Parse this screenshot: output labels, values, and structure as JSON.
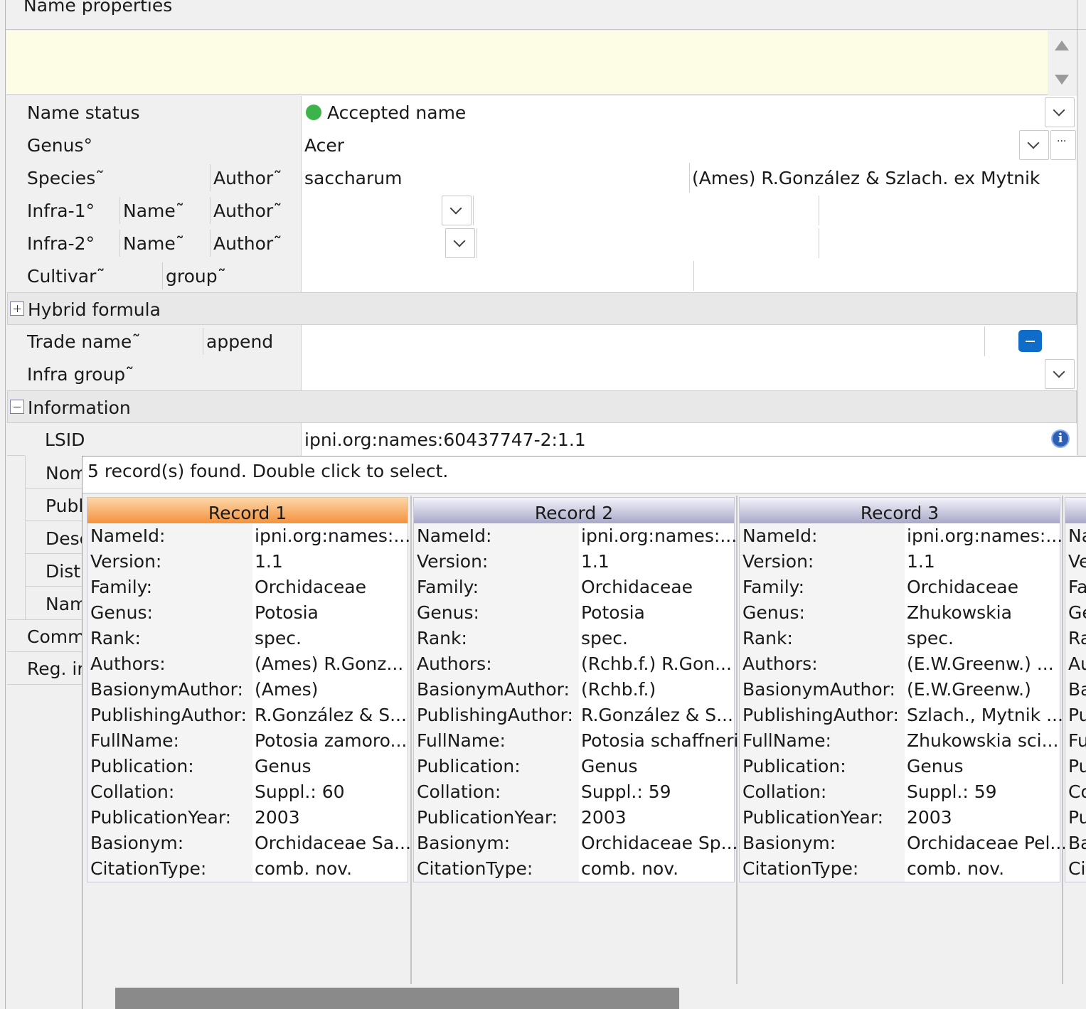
{
  "panel": {
    "title": "Name properties"
  },
  "fields": {
    "name_status": {
      "label": "Name status",
      "value": "Accepted name"
    },
    "genus": {
      "label": "Genus°",
      "value": "Acer",
      "browse": "···"
    },
    "species": {
      "label": "Species˜",
      "author_label": "Author˜",
      "value": "saccharum",
      "author_value": "(Ames) R.González & Szlach. ex Mytnik"
    },
    "infra1": {
      "label": "Infra-1°",
      "name_label": "Name˜",
      "author_label": "Author˜"
    },
    "infra2": {
      "label": "Infra-2°",
      "name_label": "Name˜",
      "author_label": "Author˜"
    },
    "cultivar": {
      "label": "Cultivar˜",
      "group_label": "group˜"
    },
    "hybrid_formula": {
      "label": "Hybrid formula"
    },
    "trade_name": {
      "label": "Trade name˜",
      "append_label": "append"
    },
    "infra_group": {
      "label": "Infra group˜"
    },
    "information": {
      "label": "Information"
    },
    "lsid": {
      "label": "LSID",
      "value": "ipni.org:names:60437747-2:1.1"
    },
    "hidden_labels": [
      "Nom",
      "Publ",
      "Desc",
      "Distr",
      "Nam"
    ],
    "comm_label": "Comm",
    "reg_label": "Reg. ir"
  },
  "popup": {
    "message": "5 record(s) found. Double click to select.",
    "field_names": [
      "NameId:",
      "Version:",
      "Family:",
      "Genus:",
      "Rank:",
      "Authors:",
      "BasionymAuthor:",
      "PublishingAuthor:",
      "FullName:",
      "Publication:",
      "Collation:",
      "PublicationYear:",
      "Basionym:",
      "CitationType:"
    ],
    "partial_field_names": [
      "Na",
      "Ve",
      "Fa",
      "Ge",
      "Ra",
      "Au",
      "Ba",
      "Pu",
      "Fu",
      "Pu",
      "Co",
      "Pu",
      "Ba",
      "Cit"
    ],
    "records": [
      {
        "title": "Record 1",
        "values": [
          "ipni.org:names:...",
          "1.1",
          "Orchidaceae",
          "Potosia",
          "spec.",
          "(Ames) R.Gonz...",
          "(Ames)",
          "R.González & S...",
          "Potosia zamoro...",
          "Genus",
          "Suppl.: 60",
          "2003",
          "Orchidaceae Sa...",
          "comb. nov."
        ]
      },
      {
        "title": "Record 2",
        "values": [
          "ipni.org:names:...",
          "1.1",
          "Orchidaceae",
          "Potosia",
          "spec.",
          "(Rchb.f.) R.Gon...",
          "(Rchb.f.)",
          "R.González & S...",
          "Potosia schaffneri",
          "Genus",
          "Suppl.: 59",
          "2003",
          "Orchidaceae Sp...",
          "comb. nov."
        ]
      },
      {
        "title": "Record 3",
        "values": [
          "ipni.org:names:...",
          "1.1",
          "Orchidaceae",
          "Zhukowskia",
          "spec.",
          "(E.W.Greenw.) ...",
          "(E.W.Greenw.)",
          "Szlach., Mytnik ...",
          "Zhukowskia sci...",
          "Genus",
          "Suppl.: 59",
          "2003",
          "Orchidaceae Pel...",
          "comb. nov."
        ]
      }
    ]
  },
  "colors": {
    "note_background": "#fdfde6",
    "status_accepted": "#3cb44b",
    "selected_header": "#f3923c",
    "record_header": "#a8a8c8",
    "action_blue": "#0f6cc8"
  }
}
